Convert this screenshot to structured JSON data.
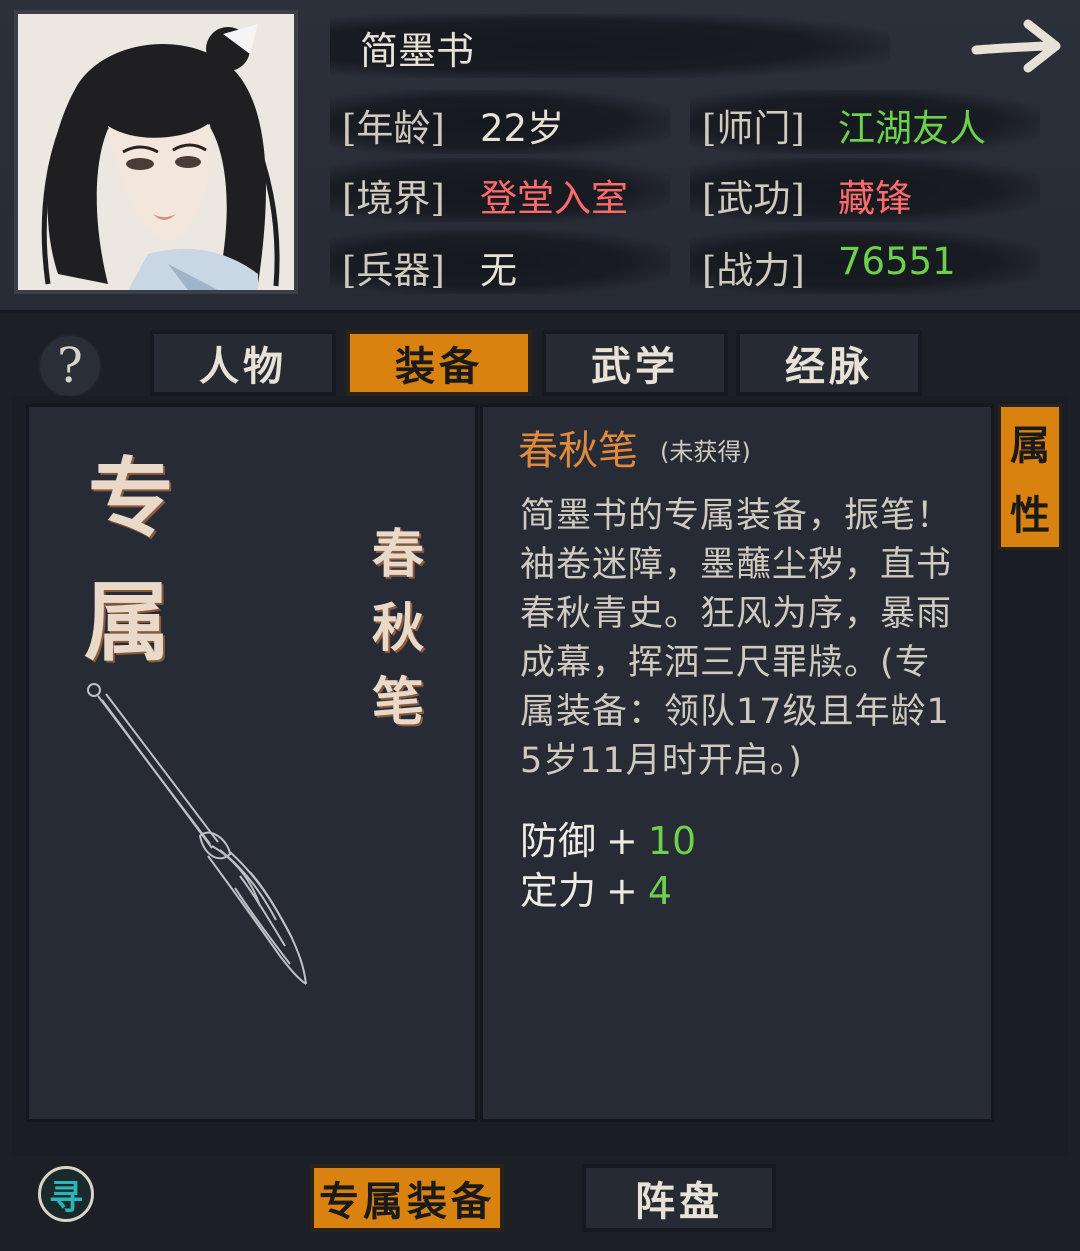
{
  "character": {
    "name": "简墨书",
    "stats": [
      {
        "label": "[年龄]",
        "value": "22岁",
        "color": "#e8e2d6"
      },
      {
        "label": "[师门]",
        "value": "江湖友人",
        "color": "#6cd04a"
      },
      {
        "label": "[境界]",
        "value": "登堂入室",
        "color": "#ff6a6a"
      },
      {
        "label": "[武功]",
        "value": "藏锋",
        "color": "#ff6a6a"
      },
      {
        "label": "[兵器]",
        "value": "无",
        "color": "#e8e2d6"
      },
      {
        "label": "[战力]",
        "value": "76551",
        "color": "#6cd04a"
      }
    ]
  },
  "help_icon": "question-mark-icon",
  "tabs": [
    {
      "label": "人物",
      "active": false
    },
    {
      "label": "装备",
      "active": true
    },
    {
      "label": "武学",
      "active": false
    },
    {
      "label": "经脉",
      "active": false
    }
  ],
  "left_panel": {
    "category_chars": [
      "专",
      "属"
    ],
    "item_name_vertical": [
      "春",
      "秋",
      "笔"
    ],
    "item_icon": "calligraphy-brush-icon"
  },
  "item": {
    "name": "春秋笔",
    "status": "(未获得)",
    "description": "简墨书的专属装备，振笔！袖卷迷障，墨蘸尘秽，直书春秋青史。狂风为序，暴雨成幕，挥洒三尺罪牍。(专属装备：领队17级且年龄15岁11月时开启。)",
    "attributes": [
      {
        "name": "防御",
        "plus": "+",
        "value": "10"
      },
      {
        "name": "定力",
        "plus": "+",
        "value": "4"
      }
    ]
  },
  "side_tab": {
    "chars": [
      "属",
      "性"
    ]
  },
  "bottom": {
    "seek_label": "寻",
    "tabs": [
      {
        "label": "专属装备",
        "active": true
      },
      {
        "label": "阵盘",
        "active": false
      }
    ]
  },
  "colors": {
    "accent": "#d9820f",
    "positive": "#6cd04a",
    "negative": "#ff6a6a",
    "item_title": "#e08a3c"
  }
}
